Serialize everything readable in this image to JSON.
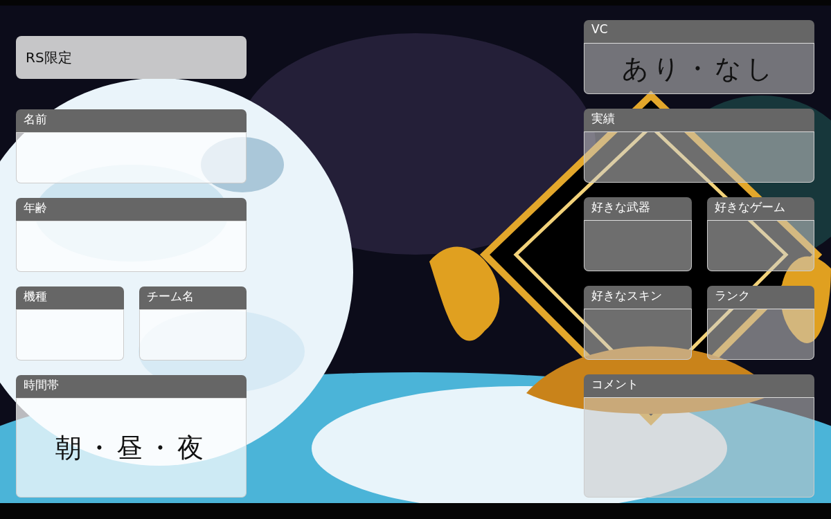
{
  "badge": "RS限定",
  "left_rows": [
    [
      {
        "label": "名前"
      }
    ],
    [
      {
        "label": "年齢"
      }
    ],
    [
      {
        "label": "機種"
      },
      {
        "label": "チーム名"
      }
    ],
    [
      {
        "label": "時間帯",
        "value": "朝・昼・夜"
      }
    ]
  ],
  "right_rows": [
    [
      {
        "label": "VC",
        "value": "あり・なし"
      }
    ],
    [
      {
        "label": "実績"
      }
    ],
    [
      {
        "label": "好きな武器"
      },
      {
        "label": "好きなゲーム"
      }
    ],
    [
      {
        "label": "好きなスキン"
      },
      {
        "label": "ランク"
      }
    ],
    [
      {
        "label": "コメント"
      }
    ]
  ]
}
